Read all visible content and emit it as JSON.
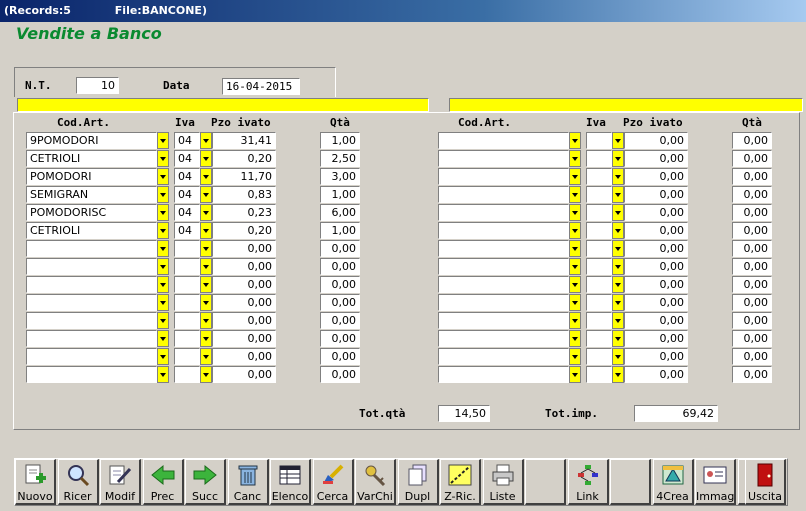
{
  "titlebar": {
    "records": "(Records:5",
    "file": "File:BANCONE)"
  },
  "app_title": "Vendite a Banco",
  "header": {
    "nt_label": "N.T.",
    "nt_value": "10",
    "data_label": "Data",
    "data_value": "16-04-2015"
  },
  "columns": {
    "cod_art": "Cod.Art.",
    "iva": "Iva",
    "pzo_ivato": "Pzo ivato",
    "qta": "Qtà"
  },
  "left_rows": [
    {
      "cod": "9POMODORI",
      "iva": "04",
      "pzo": "31,41",
      "qta": "1,00"
    },
    {
      "cod": "CETRIOLI",
      "iva": "04",
      "pzo": "0,20",
      "qta": "2,50"
    },
    {
      "cod": "POMODORI",
      "iva": "04",
      "pzo": "11,70",
      "qta": "3,00"
    },
    {
      "cod": "SEMIGRAN",
      "iva": "04",
      "pzo": "0,83",
      "qta": "1,00"
    },
    {
      "cod": "POMODORISC",
      "iva": "04",
      "pzo": "0,23",
      "qta": "6,00"
    },
    {
      "cod": "CETRIOLI",
      "iva": "04",
      "pzo": "0,20",
      "qta": "1,00"
    },
    {
      "cod": "",
      "iva": "",
      "pzo": "0,00",
      "qta": "0,00"
    },
    {
      "cod": "",
      "iva": "",
      "pzo": "0,00",
      "qta": "0,00"
    },
    {
      "cod": "",
      "iva": "",
      "pzo": "0,00",
      "qta": "0,00"
    },
    {
      "cod": "",
      "iva": "",
      "pzo": "0,00",
      "qta": "0,00"
    },
    {
      "cod": "",
      "iva": "",
      "pzo": "0,00",
      "qta": "0,00"
    },
    {
      "cod": "",
      "iva": "",
      "pzo": "0,00",
      "qta": "0,00"
    },
    {
      "cod": "",
      "iva": "",
      "pzo": "0,00",
      "qta": "0,00"
    },
    {
      "cod": "",
      "iva": "",
      "pzo": "0,00",
      "qta": "0,00"
    }
  ],
  "right_rows": [
    {
      "cod": "",
      "iva": "",
      "pzo": "0,00",
      "qta": "0,00"
    },
    {
      "cod": "",
      "iva": "",
      "pzo": "0,00",
      "qta": "0,00"
    },
    {
      "cod": "",
      "iva": "",
      "pzo": "0,00",
      "qta": "0,00"
    },
    {
      "cod": "",
      "iva": "",
      "pzo": "0,00",
      "qta": "0,00"
    },
    {
      "cod": "",
      "iva": "",
      "pzo": "0,00",
      "qta": "0,00"
    },
    {
      "cod": "",
      "iva": "",
      "pzo": "0,00",
      "qta": "0,00"
    },
    {
      "cod": "",
      "iva": "",
      "pzo": "0,00",
      "qta": "0,00"
    },
    {
      "cod": "",
      "iva": "",
      "pzo": "0,00",
      "qta": "0,00"
    },
    {
      "cod": "",
      "iva": "",
      "pzo": "0,00",
      "qta": "0,00"
    },
    {
      "cod": "",
      "iva": "",
      "pzo": "0,00",
      "qta": "0,00"
    },
    {
      "cod": "",
      "iva": "",
      "pzo": "0,00",
      "qta": "0,00"
    },
    {
      "cod": "",
      "iva": "",
      "pzo": "0,00",
      "qta": "0,00"
    },
    {
      "cod": "",
      "iva": "",
      "pzo": "0,00",
      "qta": "0,00"
    },
    {
      "cod": "",
      "iva": "",
      "pzo": "0,00",
      "qta": "0,00"
    }
  ],
  "totals": {
    "qta_label": "Tot.qtà",
    "qta_value": "14,50",
    "imp_label": "Tot.imp.",
    "imp_value": "69,42"
  },
  "toolbar": [
    {
      "label": "Nuovo",
      "icon": "new-document-icon"
    },
    {
      "label": "Ricer",
      "icon": "magnifier-icon"
    },
    {
      "label": "Modif",
      "icon": "edit-document-icon"
    },
    {
      "label": "Prec",
      "icon": "arrow-left-icon"
    },
    {
      "label": "Succ",
      "icon": "arrow-right-icon"
    },
    {
      "label": "Canc",
      "icon": "trash-icon"
    },
    {
      "label": "Elenco",
      "icon": "table-icon"
    },
    {
      "label": "Cerca",
      "icon": "search-brush-icon"
    },
    {
      "label": "VarChi",
      "icon": "keys-icon"
    },
    {
      "label": "Dupl",
      "icon": "duplicate-icon"
    },
    {
      "label": "Z-Ric.",
      "icon": "zoom-search-icon"
    },
    {
      "label": "Liste",
      "icon": "printer-icon"
    },
    {
      "label": "",
      "icon": "blank-icon"
    },
    {
      "label": "Link",
      "icon": "network-icon"
    },
    {
      "label": "",
      "icon": "blank-icon"
    },
    {
      "label": "4Crea",
      "icon": "create-icon"
    },
    {
      "label": "Immag",
      "icon": "image-card-icon"
    },
    {
      "label": "",
      "icon": "blank-icon"
    },
    {
      "label": "Uscita",
      "icon": "exit-door-icon"
    }
  ],
  "colors": {
    "accent_yellow": "#ffff00",
    "title_green": "#0a8a30",
    "text_blue": "#0a246a"
  }
}
